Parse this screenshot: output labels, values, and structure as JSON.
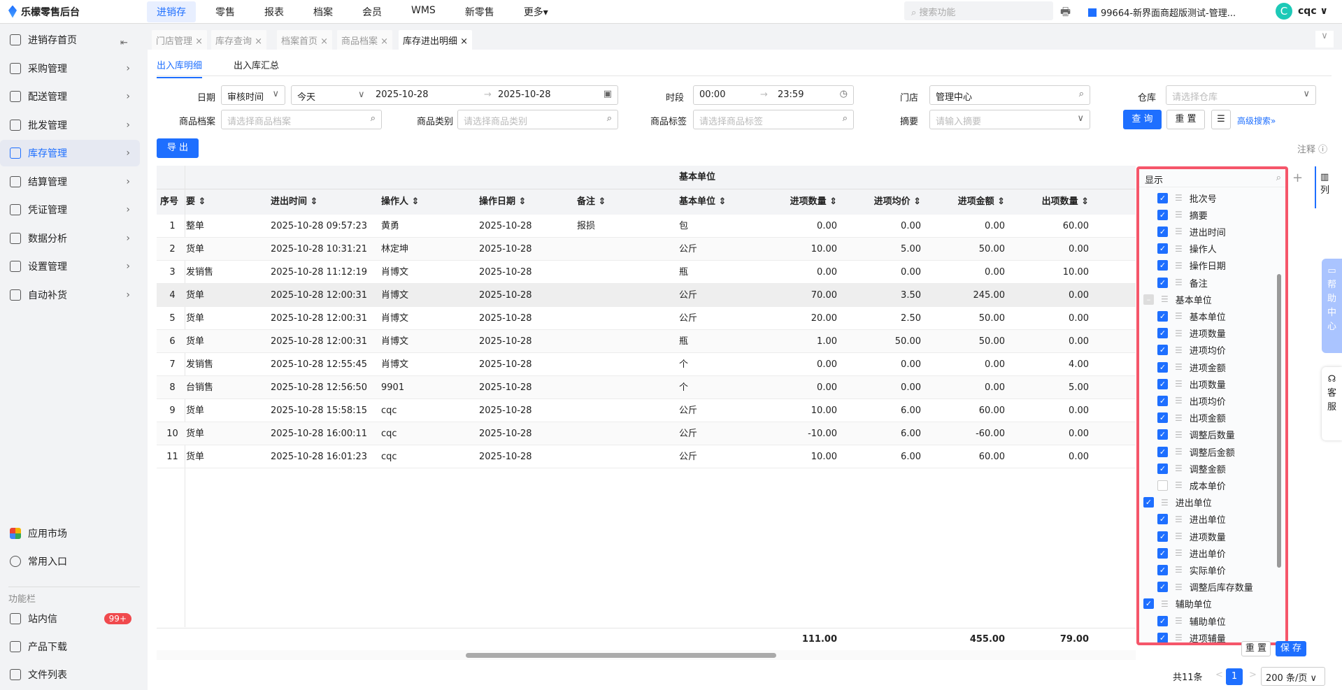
{
  "app": {
    "title": "乐檬零售后台"
  },
  "nav": [
    "进销存",
    "零售",
    "报表",
    "档案",
    "会员",
    "WMS",
    "新零售",
    "更多▾"
  ],
  "search_placeholder": "搜索功能",
  "store": "99664-新界面商超版测试-管理...",
  "user": {
    "initial": "C",
    "name": "cqc ∨"
  },
  "sidebar": {
    "items": [
      {
        "label": "进销存首页"
      },
      {
        "label": "采购管理"
      },
      {
        "label": "配送管理"
      },
      {
        "label": "批发管理"
      },
      {
        "label": "库存管理"
      },
      {
        "label": "结算管理"
      },
      {
        "label": "凭证管理"
      },
      {
        "label": "数据分析"
      },
      {
        "label": "设置管理"
      },
      {
        "label": "自动补货"
      }
    ],
    "bottom": [
      {
        "label": "应用市场"
      },
      {
        "label": "常用入口"
      }
    ],
    "section": "功能栏",
    "tools": [
      {
        "label": "站内信",
        "badge": "99+"
      },
      {
        "label": "产品下载"
      },
      {
        "label": "文件列表"
      }
    ]
  },
  "tabs": [
    "门店管理 ×",
    "库存查询 ×",
    "档案首页 ×",
    "商品档案 ×",
    "库存进出明细 ×"
  ],
  "subtabs": [
    "出入库明细",
    "出入库汇总"
  ],
  "filters": {
    "date_label": "日期",
    "date_type": "审核时间",
    "date_range": "今天",
    "date_from": "2025-10-28",
    "date_to": "2025-10-28",
    "time_label": "时段",
    "time_from": "00:00",
    "time_to": "23:59",
    "store_label": "门店",
    "store_value": "管理中心",
    "warehouse_label": "仓库",
    "warehouse_ph": "请选择仓库",
    "item_label": "商品档案",
    "item_ph": "请选择商品档案",
    "cat_label": "商品类别",
    "cat_ph": "请选择商品类别",
    "tag_label": "商品标签",
    "tag_ph": "请选择商品标签",
    "summary_label": "摘要",
    "summary_ph": "请输入摘要",
    "query": "查 询",
    "reset": "重 置",
    "advanced": "高级搜索»"
  },
  "export": "导 出",
  "note": "注释",
  "table": {
    "group_header": "基本单位",
    "columns": [
      "序号",
      "要",
      "进出时间",
      "操作人",
      "操作日期",
      "备注",
      "基本单位",
      "进项数量",
      "进项均价",
      "进项金额",
      "出项数量"
    ],
    "rows": [
      [
        "1",
        "整单",
        "2025-10-28 09:57:23",
        "黄勇",
        "2025-10-28",
        "报损",
        "包",
        "0.00",
        "0.00",
        "0.00",
        "60.00"
      ],
      [
        "2",
        "货单",
        "2025-10-28 10:31:21",
        "林定坤",
        "2025-10-28",
        "",
        "公斤",
        "10.00",
        "5.00",
        "50.00",
        "0.00"
      ],
      [
        "3",
        "发销售",
        "2025-10-28 11:12:19",
        "肖博文",
        "2025-10-28",
        "",
        "瓶",
        "0.00",
        "0.00",
        "0.00",
        "10.00"
      ],
      [
        "4",
        "货单",
        "2025-10-28 12:00:31",
        "肖博文",
        "2025-10-28",
        "",
        "公斤",
        "70.00",
        "3.50",
        "245.00",
        "0.00"
      ],
      [
        "5",
        "货单",
        "2025-10-28 12:00:31",
        "肖博文",
        "2025-10-28",
        "",
        "公斤",
        "20.00",
        "2.50",
        "50.00",
        "0.00"
      ],
      [
        "6",
        "货单",
        "2025-10-28 12:00:31",
        "肖博文",
        "2025-10-28",
        "",
        "瓶",
        "1.00",
        "50.00",
        "50.00",
        "0.00"
      ],
      [
        "7",
        "发销售",
        "2025-10-28 12:55:45",
        "肖博文",
        "2025-10-28",
        "",
        "个",
        "0.00",
        "0.00",
        "0.00",
        "4.00"
      ],
      [
        "8",
        "台销售",
        "2025-10-28 12:56:50",
        "9901",
        "2025-10-28",
        "",
        "个",
        "0.00",
        "0.00",
        "0.00",
        "5.00"
      ],
      [
        "9",
        "货单",
        "2025-10-28 15:58:15",
        "cqc",
        "2025-10-28",
        "",
        "公斤",
        "10.00",
        "6.00",
        "60.00",
        "0.00"
      ],
      [
        "10",
        "货单",
        "2025-10-28 16:00:11",
        "cqc",
        "2025-10-28",
        "",
        "公斤",
        "-10.00",
        "6.00",
        "-60.00",
        "0.00"
      ],
      [
        "11",
        "货单",
        "2025-10-28 16:01:23",
        "cqc",
        "2025-10-28",
        "",
        "公斤",
        "10.00",
        "6.00",
        "60.00",
        "0.00"
      ]
    ],
    "totals": {
      "in_qty": "111.00",
      "in_amount": "455.00",
      "out_qty": "79.00"
    }
  },
  "column_panel": {
    "title": "显示",
    "tab": "列",
    "reset": "重 置",
    "save": "保 存",
    "items": [
      {
        "label": "批次号",
        "level": 1,
        "state": "on"
      },
      {
        "label": "摘要",
        "level": 1,
        "state": "on"
      },
      {
        "label": "进出时间",
        "level": 1,
        "state": "on"
      },
      {
        "label": "操作人",
        "level": 1,
        "state": "on"
      },
      {
        "label": "操作日期",
        "level": 1,
        "state": "on"
      },
      {
        "label": "备注",
        "level": 1,
        "state": "on"
      },
      {
        "label": "基本单位",
        "level": 0,
        "state": "half"
      },
      {
        "label": "基本单位",
        "level": 1,
        "state": "on"
      },
      {
        "label": "进项数量",
        "level": 1,
        "state": "on"
      },
      {
        "label": "进项均价",
        "level": 1,
        "state": "on"
      },
      {
        "label": "进项金额",
        "level": 1,
        "state": "on"
      },
      {
        "label": "出项数量",
        "level": 1,
        "state": "on"
      },
      {
        "label": "出项均价",
        "level": 1,
        "state": "on"
      },
      {
        "label": "出项金额",
        "level": 1,
        "state": "on"
      },
      {
        "label": "调整后数量",
        "level": 1,
        "state": "on"
      },
      {
        "label": "调整后金额",
        "level": 1,
        "state": "on"
      },
      {
        "label": "调整金额",
        "level": 1,
        "state": "on"
      },
      {
        "label": "成本单价",
        "level": 1,
        "state": "off"
      },
      {
        "label": "进出单位",
        "level": 0,
        "state": "on"
      },
      {
        "label": "进出单位",
        "level": 1,
        "state": "on"
      },
      {
        "label": "进项数量",
        "level": 1,
        "state": "on"
      },
      {
        "label": "进出单价",
        "level": 1,
        "state": "on"
      },
      {
        "label": "实际单价",
        "level": 1,
        "state": "on"
      },
      {
        "label": "调整后库存数量",
        "level": 1,
        "state": "on"
      },
      {
        "label": "辅助单位",
        "level": 0,
        "state": "on"
      },
      {
        "label": "辅助单位",
        "level": 1,
        "state": "on"
      },
      {
        "label": "进项辅量",
        "level": 1,
        "state": "on"
      }
    ]
  },
  "float": {
    "help": "帮助中心",
    "service": "客服"
  },
  "pagination": {
    "total": "共11条",
    "page": "1",
    "size": "200 条/页"
  },
  "colors": {
    "accent": "#1e6fff",
    "highlight_border": "#f5566a",
    "badge": "#f0494d"
  }
}
